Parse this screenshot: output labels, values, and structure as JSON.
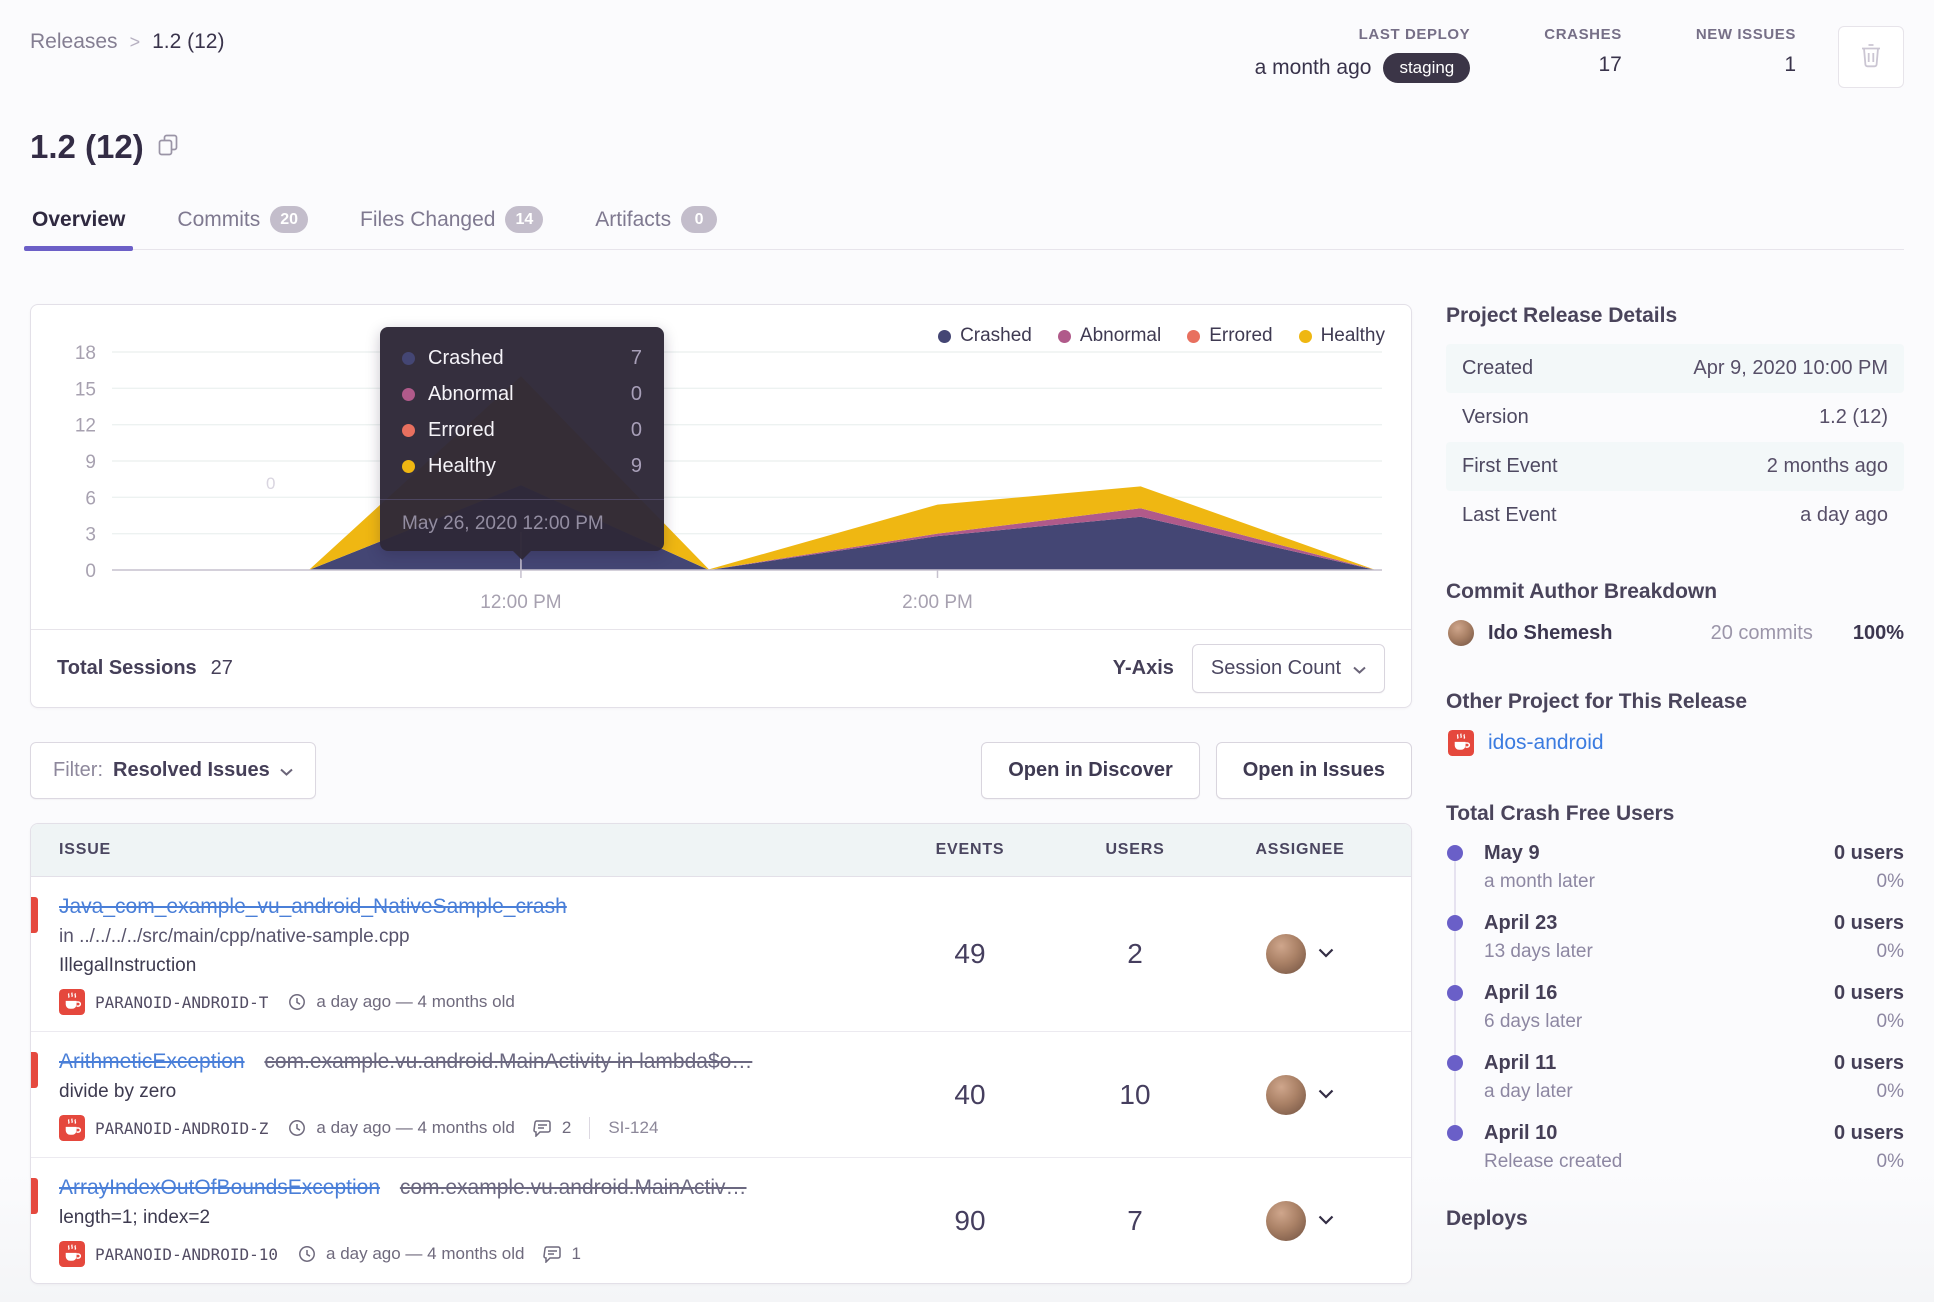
{
  "breadcrumb": {
    "parent": "Releases",
    "separator": ">",
    "current": "1.2 (12)"
  },
  "header": {
    "stats": [
      {
        "label": "LAST DEPLOY",
        "value": "a month ago",
        "badge": "staging"
      },
      {
        "label": "CRASHES",
        "value": "17"
      },
      {
        "label": "NEW ISSUES",
        "value": "1"
      }
    ],
    "title": "1.2 (12)"
  },
  "tabs": [
    {
      "label": "Overview",
      "badge": null
    },
    {
      "label": "Commits",
      "badge": "20"
    },
    {
      "label": "Files Changed",
      "badge": "14"
    },
    {
      "label": "Artifacts",
      "badge": "0"
    }
  ],
  "chart_data": {
    "type": "area",
    "stacked": true,
    "legend_position": "top-right",
    "grid": true,
    "y_axis": {
      "ticks": [
        0,
        3,
        6,
        9,
        12,
        15,
        18
      ],
      "max": 18
    },
    "x_axis": {
      "ticks": [
        {
          "label": "12:00 PM",
          "x": 0.322
        },
        {
          "label": "2:00 PM",
          "x": 0.65
        }
      ]
    },
    "series": [
      {
        "name": "Crashed",
        "color": "#444674",
        "points": [
          [
            0,
            0
          ],
          [
            0.155,
            0
          ],
          [
            0.322,
            7
          ],
          [
            0.47,
            0
          ],
          [
            0.65,
            2.8
          ],
          [
            0.81,
            4.4
          ],
          [
            0.995,
            0
          ]
        ]
      },
      {
        "name": "Abnormal",
        "color": "#b05a8a",
        "points": [
          [
            0,
            0
          ],
          [
            0.155,
            0
          ],
          [
            0.322,
            0
          ],
          [
            0.47,
            0
          ],
          [
            0.65,
            0.2
          ],
          [
            0.81,
            0.7
          ],
          [
            0.995,
            0
          ]
        ]
      },
      {
        "name": "Errored",
        "color": "#e8705f",
        "points": [
          [
            0,
            0
          ],
          [
            0.155,
            0
          ],
          [
            0.322,
            0
          ],
          [
            0.47,
            0
          ],
          [
            0.65,
            0
          ],
          [
            0.81,
            0
          ],
          [
            0.995,
            0
          ]
        ]
      },
      {
        "name": "Healthy",
        "color": "#efb712",
        "points": [
          [
            0,
            0
          ],
          [
            0.155,
            0
          ],
          [
            0.322,
            9
          ],
          [
            0.47,
            0.05
          ],
          [
            0.65,
            2.4
          ],
          [
            0.81,
            1.8
          ],
          [
            0.995,
            0
          ]
        ]
      }
    ],
    "hovered_x_fraction": 0.322,
    "zero_label": {
      "text": "0",
      "x": 0.125,
      "value": 6.7
    }
  },
  "tooltip": {
    "rows": [
      {
        "label": "Crashed",
        "value": "7"
      },
      {
        "label": "Abnormal",
        "value": "0"
      },
      {
        "label": "Errored",
        "value": "0"
      },
      {
        "label": "Healthy",
        "value": "9"
      }
    ],
    "date": "May 26, 2020 12:00 PM"
  },
  "sessions": {
    "total_label": "Total Sessions",
    "total_value": "27",
    "yaxis_label": "Y-Axis",
    "yaxis_value": "Session Count"
  },
  "filter": {
    "prefix": "Filter:",
    "value": "Resolved Issues"
  },
  "actions": {
    "discover": "Open in Discover",
    "issues": "Open in Issues"
  },
  "issues": {
    "columns": {
      "issue": "ISSUE",
      "events": "EVENTS",
      "users": "USERS",
      "assignee": "ASSIGNEE"
    },
    "rows": [
      {
        "title": "Java_com_example_vu_android_NativeSample_crash",
        "location": "in ../../../../src/main/cpp/native-sample.cpp",
        "detail": "IllegalInstruction",
        "project": "PARANOID-ANDROID-T",
        "age": "a day ago — 4 months old",
        "events": "49",
        "users": "2"
      },
      {
        "title": "ArithmeticException",
        "suffix": "com.example.vu.android.MainActivity in lambda$o…",
        "detail": "divide by zero",
        "project": "PARANOID-ANDROID-Z",
        "age": "a day ago — 4 months old",
        "comments": "2",
        "ref": "SI-124",
        "events": "40",
        "users": "10"
      },
      {
        "title": "ArrayIndexOutOfBoundsException",
        "suffix": "com.example.vu.android.MainActiv…",
        "detail": "length=1; index=2",
        "project": "PARANOID-ANDROID-10",
        "age": "a day ago — 4 months old",
        "comments": "1",
        "events": "90",
        "users": "7"
      }
    ]
  },
  "sidebar": {
    "release_details": {
      "title": "Project Release Details",
      "rows": [
        {
          "label": "Created",
          "value": "Apr 9, 2020 10:00 PM"
        },
        {
          "label": "Version",
          "value": "1.2 (12)"
        },
        {
          "label": "First Event",
          "value": "2 months ago"
        },
        {
          "label": "Last Event",
          "value": "a day ago"
        }
      ]
    },
    "commit_breakdown": {
      "title": "Commit Author Breakdown",
      "author": "Ido Shemesh",
      "commits": "20 commits",
      "percent": "100%"
    },
    "other_project": {
      "title": "Other Project for This Release",
      "link": "idos-android"
    },
    "crash_free": {
      "title": "Total Crash Free Users",
      "items": [
        {
          "date": "May 9",
          "sub": "a month later",
          "users": "0 users",
          "pct": "0%"
        },
        {
          "date": "April 23",
          "sub": "13 days later",
          "users": "0 users",
          "pct": "0%"
        },
        {
          "date": "April 16",
          "sub": "6 days later",
          "users": "0 users",
          "pct": "0%"
        },
        {
          "date": "April 11",
          "sub": "a day later",
          "users": "0 users",
          "pct": "0%"
        },
        {
          "date": "April 10",
          "sub": "Release created",
          "users": "0 users",
          "pct": "0%"
        }
      ]
    },
    "deploys_title": "Deploys"
  },
  "colors": {
    "accent": "#6c5fc7",
    "link": "#4a7fd8",
    "error": "#e5493f",
    "staging_badge": "#3b3547"
  }
}
